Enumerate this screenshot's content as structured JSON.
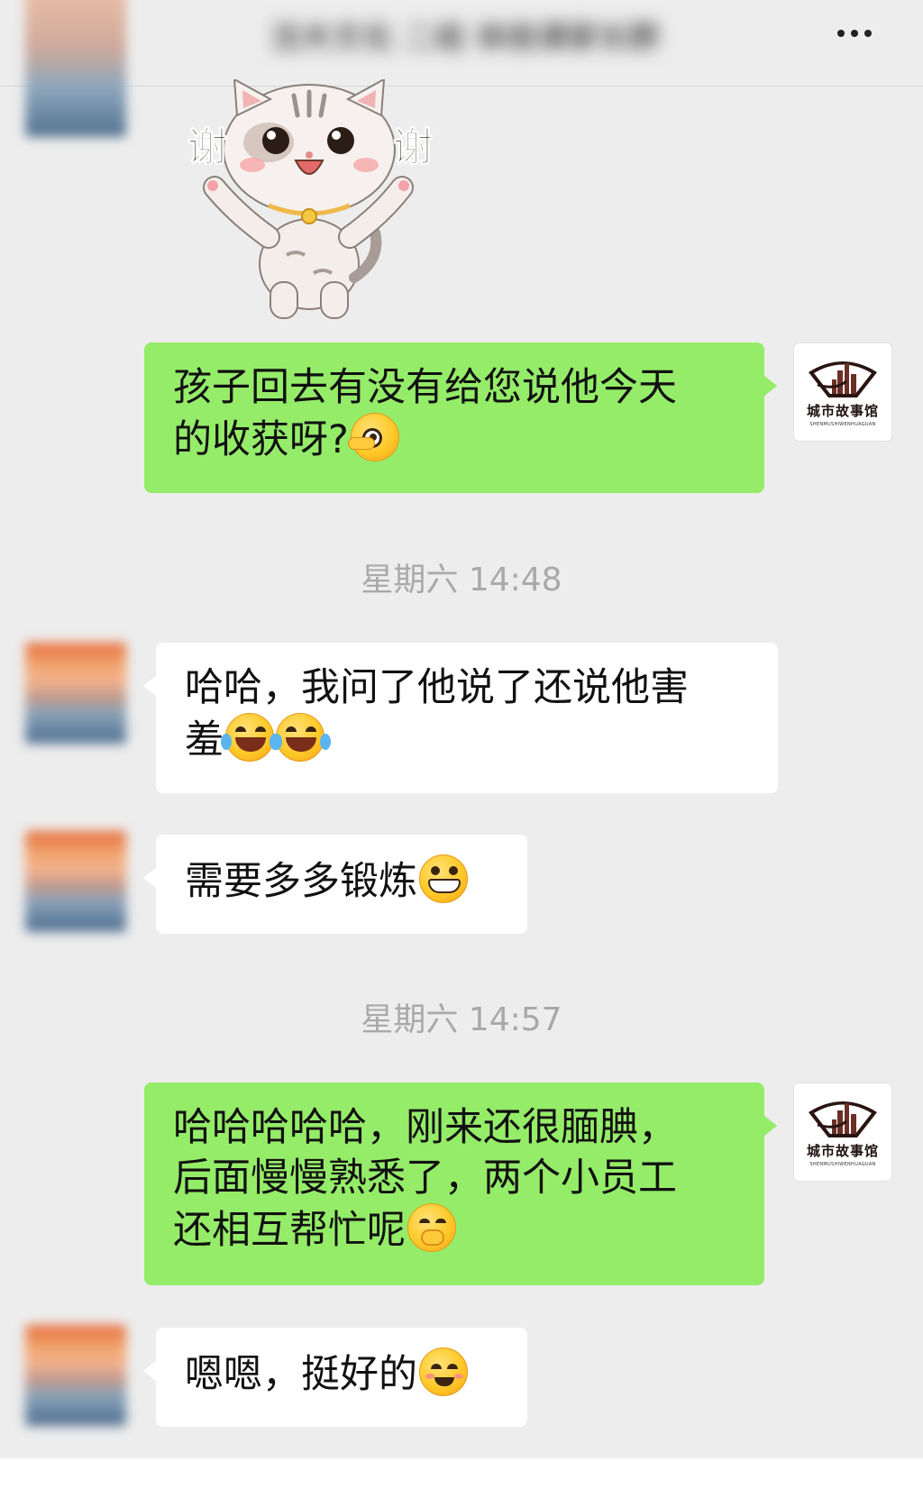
{
  "header": {
    "title": "沈木文化 二组 体验课家长群",
    "back_icon": "chevron-left-icon",
    "more_icon": "more-dots-icon"
  },
  "logo": {
    "cn": "城市故事馆",
    "en": "SHENMUSHIWENHUAGUAN"
  },
  "sticker": {
    "left_char": "谢",
    "right_char": "谢"
  },
  "messages": {
    "m1": {
      "sender": "me",
      "text": "孩子回去有没有给您说他今天\n的收获呀?",
      "emoji": "face-peeking-icon"
    },
    "t1": "星期六 14:48",
    "m2": {
      "sender": "other",
      "text": "哈哈，我问了他说了还说他害\n羞",
      "emoji": "tears-of-joy-icon"
    },
    "m3": {
      "sender": "other",
      "text": "需要多多锻炼",
      "emoji": "grin-icon"
    },
    "t2": "星期六 14:57",
    "m4": {
      "sender": "me",
      "text": "哈哈哈哈哈，刚来还很腼腆，\n后面慢慢熟悉了，两个小员工\n还相互帮忙呢",
      "emoji": "shy-giggle-icon"
    },
    "m5": {
      "sender": "other",
      "text": "嗯嗯，挺好的",
      "emoji": "smile-icon"
    }
  },
  "colors": {
    "background": "#ededed",
    "bubble_me": "#95ec69",
    "bubble_other": "#ffffff",
    "timestamp": "#a9a9a9"
  }
}
